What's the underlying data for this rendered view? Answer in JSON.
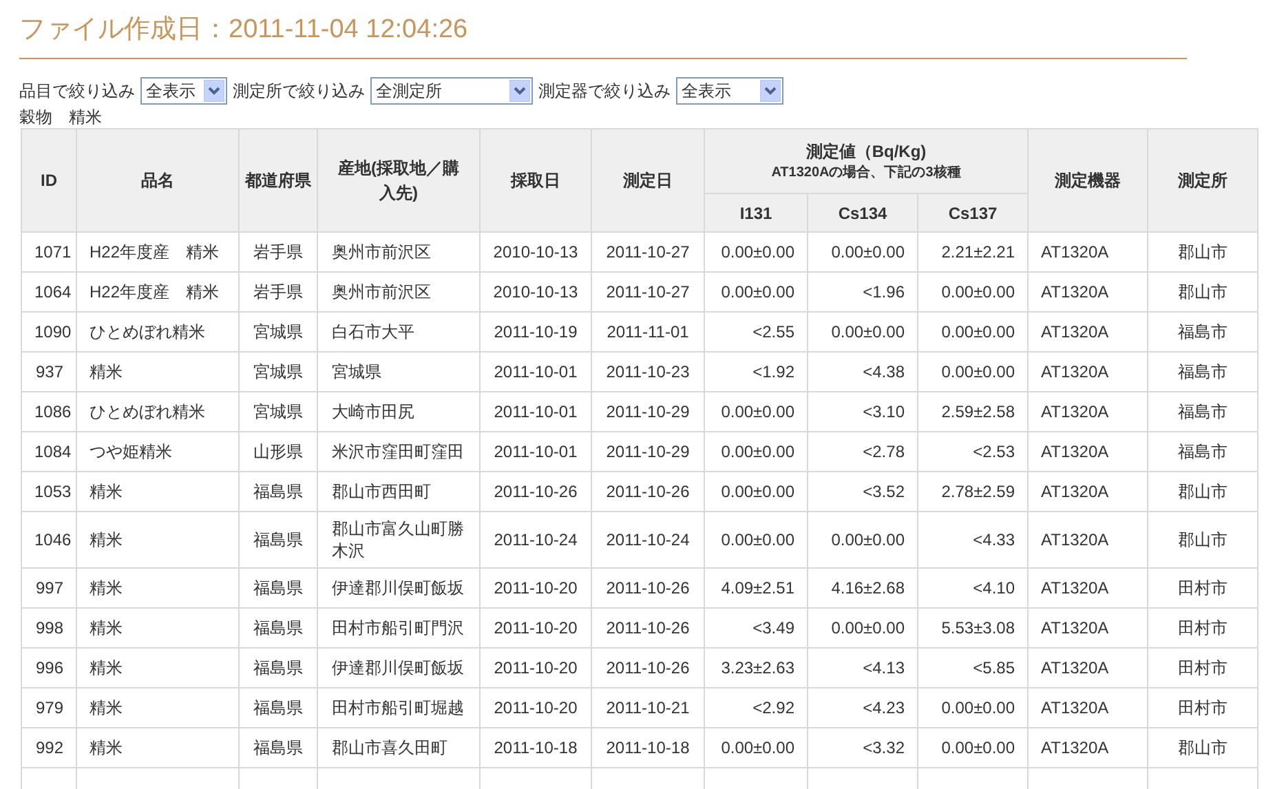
{
  "title": "ファイル作成日：2011-11-04 12:04:26",
  "filters": [
    {
      "label": "品目で絞り込み",
      "value": "全表示"
    },
    {
      "label": "測定所で絞り込み",
      "value": "全測定所"
    },
    {
      "label": "測定器で絞り込み",
      "value": "全表示"
    }
  ],
  "category": "穀物　精米",
  "table": {
    "columns": [
      "ID",
      "品名",
      "都道府県",
      "産地(採取地／購入先)",
      "採取日",
      "測定日"
    ],
    "group": {
      "title": "測定値（Bq/Kg)",
      "note": "AT1320Aの場合、下記の3核種",
      "columns": [
        "I131",
        "Cs134",
        "Cs137"
      ]
    },
    "columns_after": [
      "測定機器",
      "測定所"
    ],
    "rows": [
      [
        "1071",
        "H22年度産　精米",
        "岩手県",
        "奥州市前沢区",
        "2010-10-13",
        "2011-10-27",
        "0.00±0.00",
        "0.00±0.00",
        "2.21±2.21",
        "AT1320A",
        "郡山市"
      ],
      [
        "1064",
        "H22年度産　精米",
        "岩手県",
        "奥州市前沢区",
        "2010-10-13",
        "2011-10-27",
        "0.00±0.00",
        "<1.96",
        "0.00±0.00",
        "AT1320A",
        "郡山市"
      ],
      [
        "1090",
        "ひとめぼれ精米",
        "宮城県",
        "白石市大平",
        "2011-10-19",
        "2011-11-01",
        "<2.55",
        "0.00±0.00",
        "0.00±0.00",
        "AT1320A",
        "福島市"
      ],
      [
        "937",
        "精米",
        "宮城県",
        "宮城県",
        "2011-10-01",
        "2011-10-23",
        "<1.92",
        "<4.38",
        "0.00±0.00",
        "AT1320A",
        "福島市"
      ],
      [
        "1086",
        "ひとめぼれ精米",
        "宮城県",
        "大崎市田尻",
        "2011-10-01",
        "2011-10-29",
        "0.00±0.00",
        "<3.10",
        "2.59±2.58",
        "AT1320A",
        "福島市"
      ],
      [
        "1084",
        "つや姫精米",
        "山形県",
        "米沢市窪田町窪田",
        "2011-10-01",
        "2011-10-29",
        "0.00±0.00",
        "<2.78",
        "<2.53",
        "AT1320A",
        "福島市"
      ],
      [
        "1053",
        "精米",
        "福島県",
        "郡山市西田町",
        "2011-10-26",
        "2011-10-26",
        "0.00±0.00",
        "<3.52",
        "2.78±2.59",
        "AT1320A",
        "郡山市"
      ],
      [
        "1046",
        "精米",
        "福島県",
        "郡山市富久山町勝木沢",
        "2011-10-24",
        "2011-10-24",
        "0.00±0.00",
        "0.00±0.00",
        "<4.33",
        "AT1320A",
        "郡山市"
      ],
      [
        "997",
        "精米",
        "福島県",
        "伊達郡川俣町飯坂",
        "2011-10-20",
        "2011-10-26",
        "4.09±2.51",
        "4.16±2.68",
        "<4.10",
        "AT1320A",
        "田村市"
      ],
      [
        "998",
        "精米",
        "福島県",
        "田村市船引町門沢",
        "2011-10-20",
        "2011-10-26",
        "<3.49",
        "0.00±0.00",
        "5.53±3.08",
        "AT1320A",
        "田村市"
      ],
      [
        "996",
        "精米",
        "福島県",
        "伊達郡川俣町飯坂",
        "2011-10-20",
        "2011-10-26",
        "3.23±2.63",
        "<4.13",
        "<5.85",
        "AT1320A",
        "田村市"
      ],
      [
        "979",
        "精米",
        "福島県",
        "田村市船引町堀越",
        "2011-10-20",
        "2011-10-21",
        "<2.92",
        "<4.23",
        "0.00±0.00",
        "AT1320A",
        "田村市"
      ],
      [
        "992",
        "精米",
        "福島県",
        "郡山市喜久田町",
        "2011-10-18",
        "2011-10-18",
        "0.00±0.00",
        "<3.32",
        "0.00±0.00",
        "AT1320A",
        "郡山市"
      ]
    ]
  }
}
